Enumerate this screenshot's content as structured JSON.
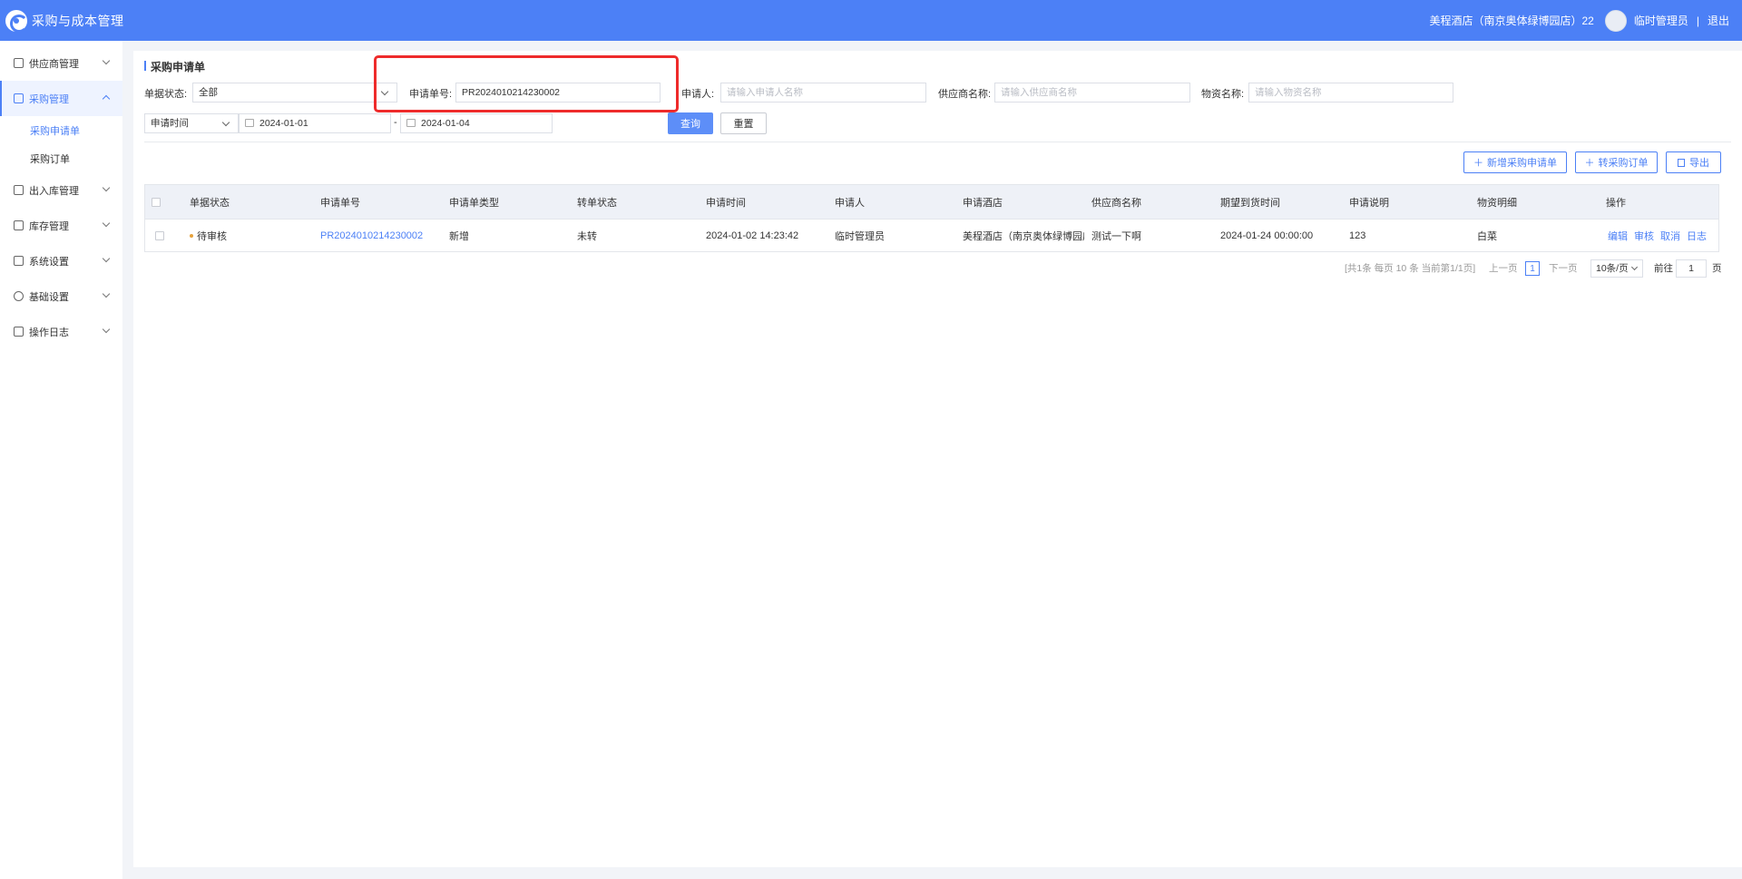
{
  "header": {
    "app_title": "采购与成本管理",
    "hotel": "美程酒店（南京奥体绿博园店）22",
    "user": "临时管理员",
    "separator": "|",
    "logout": "退出"
  },
  "sidebar": {
    "items": [
      {
        "label": "供应商管理"
      },
      {
        "label": "采购管理"
      },
      {
        "label": "出入库管理"
      },
      {
        "label": "库存管理"
      },
      {
        "label": "系统设置"
      },
      {
        "label": "基础设置"
      },
      {
        "label": "操作日志"
      }
    ],
    "sub_items": [
      {
        "label": "采购申请单"
      },
      {
        "label": "采购订单"
      }
    ]
  },
  "page": {
    "title": "采购申请单"
  },
  "filters": {
    "status_label": "单据状态:",
    "status_value": "全部",
    "no_label": "申请单号:",
    "no_value": "PR2024010214230002",
    "applicant_label": "申请人:",
    "applicant_placeholder": "请输入申请人名称",
    "supplier_label": "供应商名称:",
    "supplier_placeholder": "请输入供应商名称",
    "material_label": "物资名称:",
    "material_placeholder": "请输入物资名称",
    "date_type": "申请时间",
    "date_start": "2024-01-01",
    "date_sep": "-",
    "date_end": "2024-01-04",
    "query_label": "查询",
    "reset_label": "重置"
  },
  "actions": {
    "add_label": "新增采购申请单",
    "convert_label": "转采购订单",
    "export_label": "导出"
  },
  "table": {
    "columns": [
      "单据状态",
      "申请单号",
      "申请单类型",
      "转单状态",
      "申请时间",
      "申请人",
      "申请酒店",
      "供应商名称",
      "期望到货时间",
      "申请说明",
      "物资明细",
      "操作"
    ],
    "rows": [
      {
        "status": "待审核",
        "no": "PR2024010214230002",
        "type": "新增",
        "convert_status": "未转",
        "time": "2024-01-02 14:23:42",
        "applicant": "临时管理员",
        "hotel": "美程酒店（南京奥体绿博园店）",
        "supplier": "测试一下啊",
        "expected_time": "2024-01-24 00:00:00",
        "remark": "123",
        "material": "白菜",
        "ops": [
          "编辑",
          "审核",
          "取消",
          "日志"
        ]
      }
    ]
  },
  "pagination": {
    "summary": "[共1条 每页 10 条 当前第1/1页]",
    "prev": "上一页",
    "current": "1",
    "next": "下一页",
    "page_size": "10条/页",
    "goto_label": "前往",
    "goto_value": "1",
    "page_suffix": "页"
  }
}
